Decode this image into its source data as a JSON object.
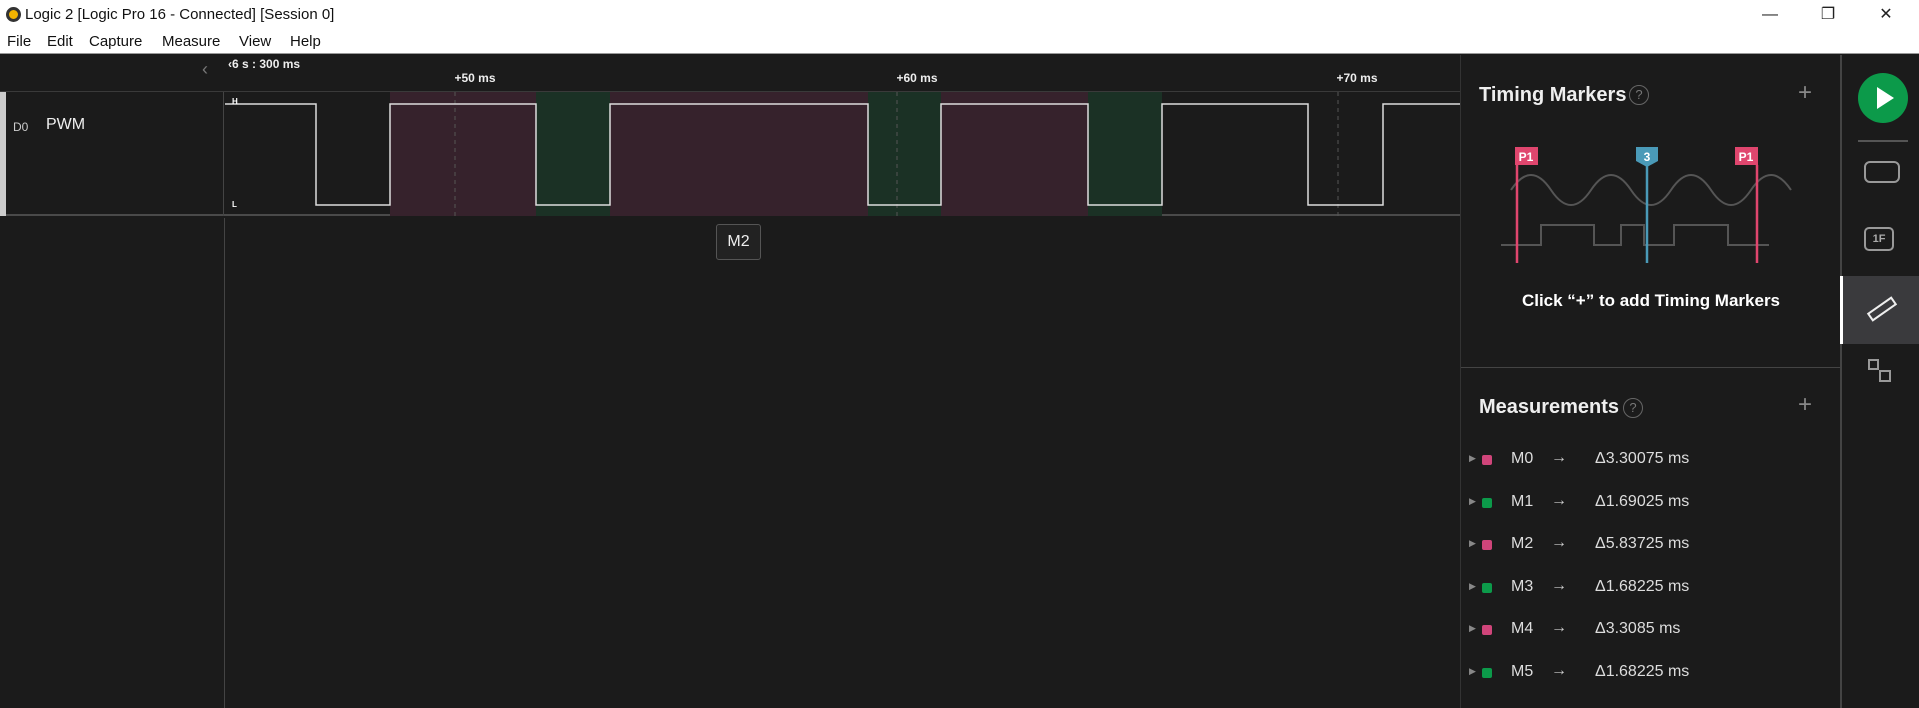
{
  "window": {
    "title": "Logic 2 [Logic Pro 16 - Connected] [Session 0]",
    "minimize": "—",
    "restore": "❐",
    "close": "✕"
  },
  "menu": [
    "File",
    "Edit",
    "Capture",
    "Measure",
    "View",
    "Help"
  ],
  "ruler": {
    "origin": "‹6 s : 300 ms",
    "ticks": [
      "+50 ms",
      "+60 ms",
      "+70 ms"
    ]
  },
  "channel": {
    "id": "D0",
    "name": "PWM",
    "high_label": "H",
    "low_label": "L"
  },
  "tooltip": "M2",
  "timing_markers": {
    "title": "Timing Markers",
    "help": "?",
    "add": "+",
    "hint": "Click “+” to add Timing Markers",
    "illustration_labels": [
      "P1",
      "3",
      "P1"
    ]
  },
  "measurements": {
    "title": "Measurements",
    "help": "?",
    "add": "+",
    "colors": {
      "pink": "#d0457a",
      "green": "#0c9a4a"
    },
    "items": [
      {
        "name": "M0",
        "arrow": "→",
        "value": "Δ3.30075 ms",
        "color": "pink"
      },
      {
        "name": "M1",
        "arrow": "→",
        "value": "Δ1.69025 ms",
        "color": "green"
      },
      {
        "name": "M2",
        "arrow": "→",
        "value": "Δ5.83725 ms",
        "color": "pink"
      },
      {
        "name": "M3",
        "arrow": "→",
        "value": "Δ1.68225 ms",
        "color": "green"
      },
      {
        "name": "M4",
        "arrow": "→",
        "value": "Δ3.3085 ms",
        "color": "pink"
      },
      {
        "name": "M5",
        "arrow": "→",
        "value": "Δ1.68225 ms",
        "color": "green"
      }
    ]
  },
  "sidebar": {
    "accent": "#0c9a4a"
  }
}
